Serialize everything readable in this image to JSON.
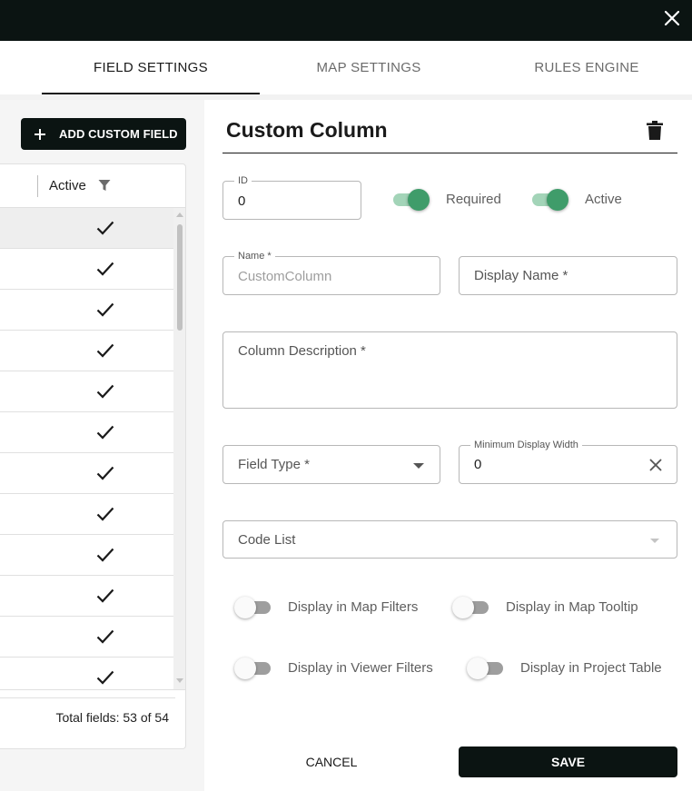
{
  "tabs": [
    {
      "label": "FIELD SETTINGS",
      "active": true
    },
    {
      "label": "MAP SETTINGS",
      "active": false
    },
    {
      "label": "RULES ENGINE",
      "active": false
    }
  ],
  "toolbar": {
    "add_custom_field_label": "ADD CUSTOM FIELD"
  },
  "table": {
    "column_header": "Active",
    "rows": [
      true,
      true,
      true,
      true,
      true,
      true,
      true,
      true,
      true,
      true,
      true,
      true
    ],
    "footer": "Total fields: 53 of 54"
  },
  "form": {
    "title": "Custom Column",
    "id": {
      "label": "ID",
      "value": "0"
    },
    "required": {
      "label": "Required",
      "checked": true
    },
    "active": {
      "label": "Active",
      "checked": true
    },
    "name": {
      "label": "Name *",
      "value": "CustomColumn"
    },
    "display_name": {
      "placeholder": "Display Name *"
    },
    "description": {
      "placeholder": "Column Description *"
    },
    "field_type": {
      "placeholder": "Field Type *"
    },
    "min_display_width": {
      "label": "Minimum Display Width",
      "value": "0"
    },
    "code_list": {
      "placeholder": "Code List"
    },
    "toggles": [
      {
        "label": "Display in Map Filters",
        "checked": false
      },
      {
        "label": "Display in Map Tooltip",
        "checked": false
      },
      {
        "label": "Display in Viewer Filters",
        "checked": false
      },
      {
        "label": "Display in Project Table",
        "checked": false
      }
    ],
    "cancel_label": "CANCEL",
    "save_label": "SAVE"
  },
  "colors": {
    "header_bg": "#0b1412",
    "toggle_on": "#3f9c6a",
    "toggle_track_on": "#a3d4b8"
  },
  "icons": [
    "close-icon",
    "plus-icon",
    "filter-icon",
    "check-icon",
    "trash-icon",
    "dropdown-caret-icon",
    "clear-icon"
  ]
}
